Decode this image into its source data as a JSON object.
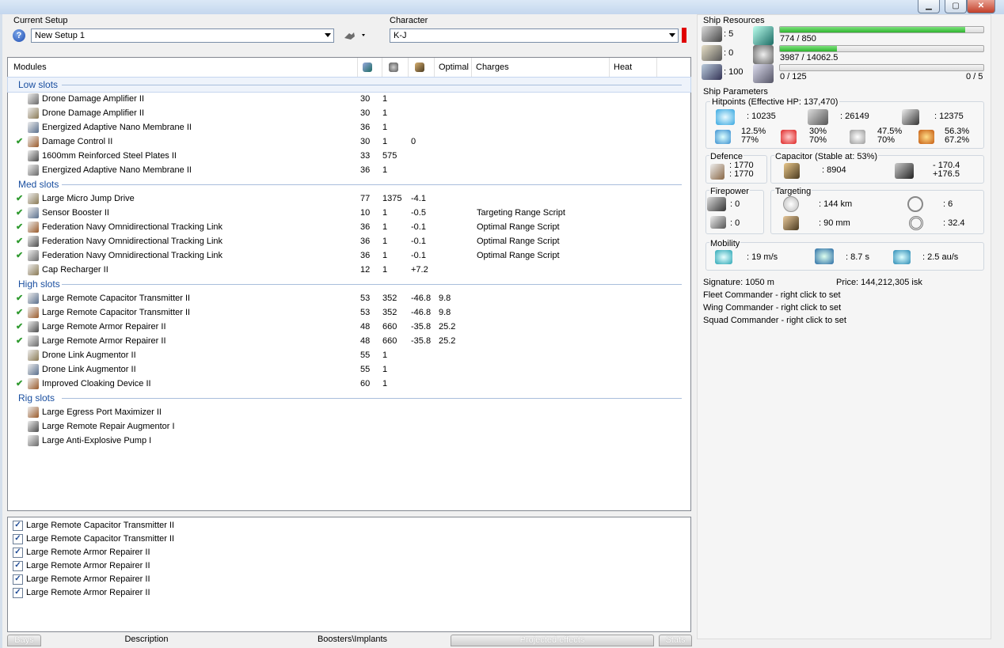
{
  "window": {
    "min_label": "▭",
    "max_label": "▢",
    "close_label": "✕"
  },
  "setup": {
    "label": "Current Setup",
    "value": "New Setup 1"
  },
  "character": {
    "label": "Character",
    "value": "K-J",
    "status_color": "#e00000"
  },
  "modules": {
    "headers": {
      "modules": "Modules",
      "optimal": "Optimal",
      "charges": "Charges",
      "heat": "Heat"
    },
    "sections": [
      {
        "title": "Low slots",
        "rows": [
          {
            "checked": false,
            "name": "Drone Damage Amplifier II",
            "c1": "30",
            "c2": "1",
            "c3": "",
            "opt": "",
            "charge": ""
          },
          {
            "checked": false,
            "name": "Drone Damage Amplifier II",
            "c1": "30",
            "c2": "1",
            "c3": "",
            "opt": "",
            "charge": ""
          },
          {
            "checked": false,
            "name": "Energized Adaptive Nano Membrane II",
            "c1": "36",
            "c2": "1",
            "c3": "",
            "opt": "",
            "charge": ""
          },
          {
            "checked": true,
            "name": "Damage Control II",
            "c1": "30",
            "c2": "1",
            "c3": "0",
            "opt": "",
            "charge": ""
          },
          {
            "checked": false,
            "name": "1600mm Reinforced Steel Plates II",
            "c1": "33",
            "c2": "575",
            "c3": "",
            "opt": "",
            "charge": ""
          },
          {
            "checked": false,
            "name": "Energized Adaptive Nano Membrane II",
            "c1": "36",
            "c2": "1",
            "c3": "",
            "opt": "",
            "charge": ""
          }
        ]
      },
      {
        "title": "Med slots",
        "rows": [
          {
            "checked": true,
            "name": "Large Micro Jump Drive",
            "c1": "77",
            "c2": "1375",
            "c3": "-4.1",
            "opt": "",
            "charge": ""
          },
          {
            "checked": true,
            "name": "Sensor Booster II",
            "c1": "10",
            "c2": "1",
            "c3": "-0.5",
            "opt": "",
            "charge": "Targeting Range Script"
          },
          {
            "checked": true,
            "name": "Federation Navy Omnidirectional Tracking Link",
            "c1": "36",
            "c2": "1",
            "c3": "-0.1",
            "opt": "",
            "charge": "Optimal Range Script"
          },
          {
            "checked": true,
            "name": "Federation Navy Omnidirectional Tracking Link",
            "c1": "36",
            "c2": "1",
            "c3": "-0.1",
            "opt": "",
            "charge": "Optimal Range Script"
          },
          {
            "checked": true,
            "name": "Federation Navy Omnidirectional Tracking Link",
            "c1": "36",
            "c2": "1",
            "c3": "-0.1",
            "opt": "",
            "charge": "Optimal Range Script"
          },
          {
            "checked": false,
            "name": "Cap Recharger II",
            "c1": "12",
            "c2": "1",
            "c3": "+7.2",
            "opt": "",
            "charge": ""
          }
        ]
      },
      {
        "title": "High slots",
        "rows": [
          {
            "checked": true,
            "name": "Large Remote Capacitor Transmitter II",
            "c1": "53",
            "c2": "352",
            "c3": "-46.8",
            "opt": "9.8",
            "charge": ""
          },
          {
            "checked": true,
            "name": "Large Remote Capacitor Transmitter II",
            "c1": "53",
            "c2": "352",
            "c3": "-46.8",
            "opt": "9.8",
            "charge": ""
          },
          {
            "checked": true,
            "name": "Large Remote Armor Repairer II",
            "c1": "48",
            "c2": "660",
            "c3": "-35.8",
            "opt": "25.2",
            "charge": ""
          },
          {
            "checked": true,
            "name": "Large Remote Armor Repairer II",
            "c1": "48",
            "c2": "660",
            "c3": "-35.8",
            "opt": "25.2",
            "charge": ""
          },
          {
            "checked": false,
            "name": "Drone Link Augmentor II",
            "c1": "55",
            "c2": "1",
            "c3": "",
            "opt": "",
            "charge": ""
          },
          {
            "checked": false,
            "name": "Drone Link Augmentor II",
            "c1": "55",
            "c2": "1",
            "c3": "",
            "opt": "",
            "charge": ""
          },
          {
            "checked": true,
            "name": "Improved Cloaking Device II",
            "c1": "60",
            "c2": "1",
            "c3": "",
            "opt": "",
            "charge": ""
          }
        ]
      },
      {
        "title": "Rig slots",
        "rows": [
          {
            "checked": false,
            "name": "Large Egress Port Maximizer II",
            "c1": "",
            "c2": "",
            "c3": "",
            "opt": "",
            "charge": ""
          },
          {
            "checked": false,
            "name": "Large Remote Repair Augmentor I",
            "c1": "",
            "c2": "",
            "c3": "",
            "opt": "",
            "charge": ""
          },
          {
            "checked": false,
            "name": "Large Anti-Explosive Pump I",
            "c1": "",
            "c2": "",
            "c3": "",
            "opt": "",
            "charge": ""
          }
        ]
      }
    ]
  },
  "projected": [
    "Large Remote Capacitor Transmitter II",
    "Large Remote Capacitor Transmitter II",
    "Large Remote Armor Repairer II",
    "Large Remote Armor Repairer II",
    "Large Remote Armor Repairer II",
    "Large Remote Armor Repairer II"
  ],
  "tabs": {
    "bays": "Bays",
    "description": "Description",
    "boosters": "Boosters\\Implants",
    "projected": "Projected effects",
    "stats": "Stats"
  },
  "resources": {
    "title": "Ship Resources",
    "turret": ": 5",
    "launcher": ": 0",
    "calibration": ": 100",
    "cpu": "774 / 850",
    "cpu_fill": 0.91,
    "powergrid": "3987 / 14062.5",
    "powergrid_fill": 0.28,
    "drone_bw": "0 / 125",
    "drone_count": "0 / 5",
    "drone_fill": 0.0
  },
  "params": {
    "title": "Ship Parameters",
    "hitpoints_title": "Hitpoints (Effective HP: 137,470)",
    "shield_hp": ": 10235",
    "armor_hp": ": 26149",
    "structure_hp": ": 12375",
    "res_em": [
      "12.5%",
      "77%"
    ],
    "res_thermal": [
      "30%",
      "70%"
    ],
    "res_kinetic": [
      "47.5%",
      "70%"
    ],
    "res_explosive": [
      "56.3%",
      "67.2%"
    ],
    "defence_title": "Defence",
    "defence_a": ": 1770",
    "defence_b": ": 1770",
    "capacitor_title": "Capacitor (Stable at: 53%)",
    "cap_amount": ": 8904",
    "cap_delta_use": "- 170.4",
    "cap_delta_rech": "+176.5",
    "firepower_title": "Firepower",
    "fire_a": ": 0",
    "fire_b": ": 0",
    "targeting_title": "Targeting",
    "range": ": 144 km",
    "scan_res": ": 90 mm",
    "targets": ": 6",
    "sensor": ": 32.4",
    "mobility_title": "Mobility",
    "speed": ": 19 m/s",
    "align": ": 8.7 s",
    "warp": ": 2.5 au/s",
    "signature": "Signature: 1050 m",
    "price": "Price: 144,212,305 isk",
    "fleet": "Fleet Commander - right click to set",
    "wing": "Wing Commander - right click to set",
    "squad": "Squad Commander - right click to set"
  }
}
